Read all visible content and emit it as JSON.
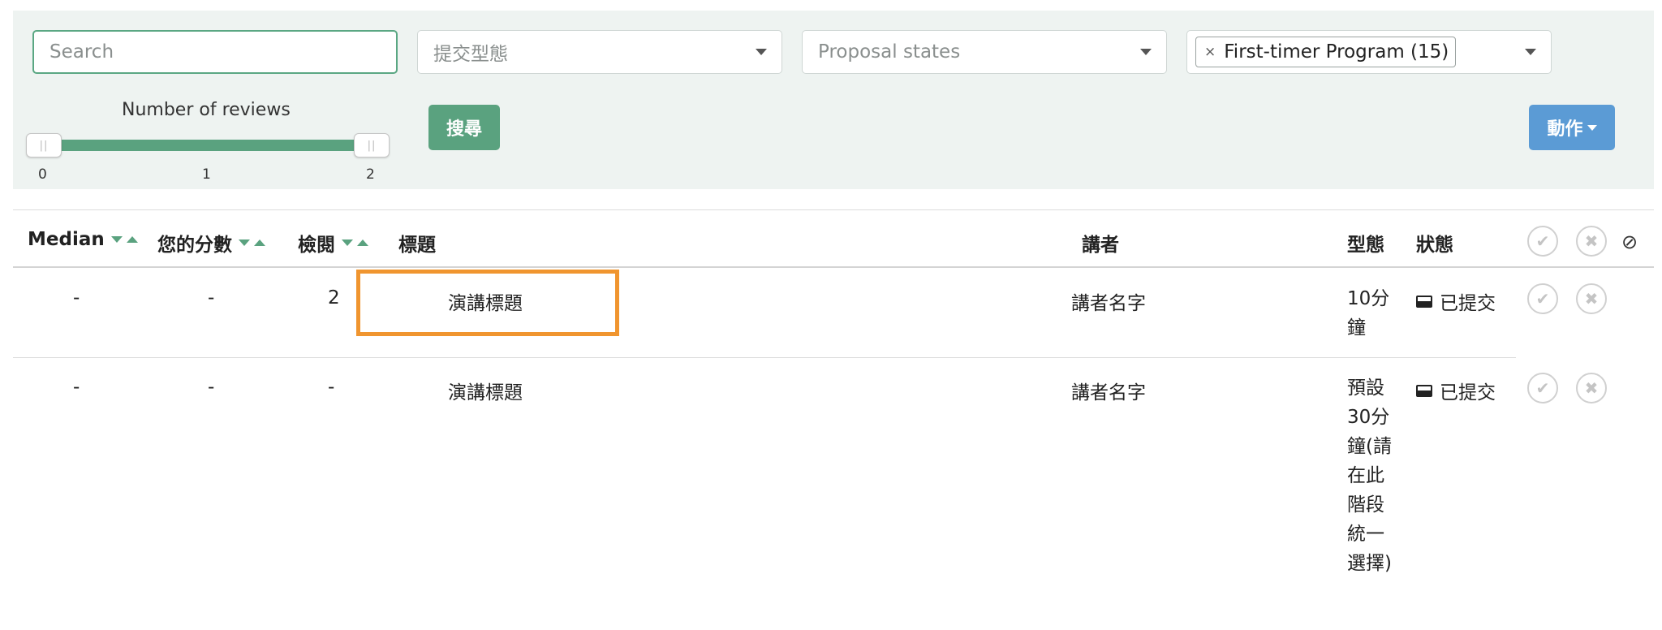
{
  "filters": {
    "search_placeholder": "Search",
    "submission_type_placeholder": "提交型態",
    "proposal_states_placeholder": "Proposal states",
    "selected_tag": "First-timer Program (15)",
    "tag_remove": "×"
  },
  "slider": {
    "title": "Number of reviews",
    "ticks": [
      "0",
      "1",
      "2"
    ],
    "range": [
      0,
      2
    ],
    "handle_glyph": "||"
  },
  "buttons": {
    "search": "搜尋",
    "action": "動作"
  },
  "table": {
    "headers": {
      "median": "Median",
      "your_score": "您的分數",
      "reviews": "檢閱",
      "title": "標題",
      "speaker": "講者",
      "type": "型態",
      "status": "狀態"
    },
    "header_icons": [
      "checkmark-icon",
      "cross-icon",
      "ban-icon"
    ],
    "rows": [
      {
        "median": "-",
        "your_score": "-",
        "reviews": "2",
        "title": "演講標題",
        "speaker": "講者名字",
        "type": "10分鐘",
        "status": "已提交"
      },
      {
        "median": "-",
        "your_score": "-",
        "reviews": "-",
        "title": "演講標題",
        "speaker": "講者名字",
        "type": "預設30分鐘(請在此階段統一選擇)",
        "status": "已提交"
      }
    ]
  },
  "icons": {
    "check": "✔",
    "cross": "✖",
    "ban": "⊘"
  },
  "colors": {
    "accent_green": "#5aa27f",
    "action_blue": "#5b9bd5",
    "highlight_orange": "#f0952f",
    "panel_bg": "#eef3f1"
  }
}
